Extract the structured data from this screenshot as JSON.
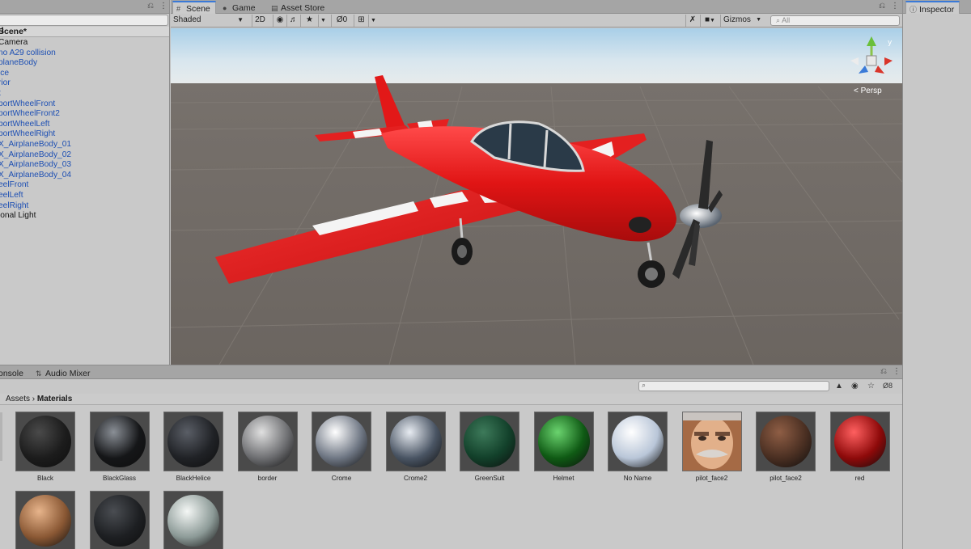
{
  "hierarchy": {
    "scene_name": "Scene*",
    "items": [
      {
        "label": "Camera",
        "color": "black"
      },
      {
        "label": "no A29 collision",
        "color": "blue"
      },
      {
        "label": "planeBody",
        "color": "blue"
      },
      {
        "label": "ice",
        "color": "blue"
      },
      {
        "label": "rior",
        "color": "blue"
      },
      {
        "label": "t",
        "color": "blue"
      },
      {
        "label": "portWheelFront",
        "color": "blue"
      },
      {
        "label": "portWheelFront2",
        "color": "blue"
      },
      {
        "label": "portWheelLeft",
        "color": "blue"
      },
      {
        "label": "portWheelRight",
        "color": "blue"
      },
      {
        "label": "X_AirplaneBody_01",
        "color": "blue"
      },
      {
        "label": "X_AirplaneBody_02",
        "color": "blue"
      },
      {
        "label": "X_AirplaneBody_03",
        "color": "blue"
      },
      {
        "label": "X_AirplaneBody_04",
        "color": "blue"
      },
      {
        "label": "eelFront",
        "color": "blue"
      },
      {
        "label": "eelLeft",
        "color": "blue"
      },
      {
        "label": "eelRight",
        "color": "blue"
      },
      {
        "label": "ional Light",
        "color": "black"
      }
    ]
  },
  "scene_tabs": [
    {
      "label": "Scene",
      "icon": "grid-icon"
    },
    {
      "label": "Game",
      "icon": "gamepad-icon"
    },
    {
      "label": "Asset Store",
      "icon": "store-icon"
    }
  ],
  "scene_toolbar": {
    "shading_mode": "Shaded",
    "mode_2d": "2D",
    "hidden_count": "0",
    "gizmos": "Gizmos",
    "search_placeholder": "All"
  },
  "viewport": {
    "projection_label": "< Persp"
  },
  "inspector": {
    "tab_label": "Inspector"
  },
  "project": {
    "tabs": [
      {
        "label": "onsole"
      },
      {
        "label": "Audio Mixer"
      }
    ],
    "layer_count": "8",
    "breadcrumb": {
      "root": "Assets",
      "current": "Materials"
    },
    "materials": [
      {
        "name": "Black",
        "type": "sphere",
        "base": "#1c1c1c",
        "hi": "#4a4a4a"
      },
      {
        "name": "BlackGlass",
        "type": "sphere",
        "base": "#151618",
        "hi": "#8a8f96"
      },
      {
        "name": "BlackHelice",
        "type": "sphere",
        "base": "#202226",
        "hi": "#5a5e66"
      },
      {
        "name": "border",
        "type": "sphere",
        "base": "#6e6f72",
        "hi": "#e0e0e0"
      },
      {
        "name": "Crome",
        "type": "sphere",
        "base": "#6f7784",
        "hi": "#ffffff"
      },
      {
        "name": "Crome2",
        "type": "sphere",
        "base": "#4a5564",
        "hi": "#e8ecf2"
      },
      {
        "name": "GreenSuit",
        "type": "sphere",
        "base": "#12402a",
        "hi": "#3d7a5a"
      },
      {
        "name": "Helmet",
        "type": "sphere",
        "base": "#0f5a14",
        "hi": "#6bd46f"
      },
      {
        "name": "No Name",
        "type": "sphere",
        "base": "#b9c6d8",
        "hi": "#ffffff"
      },
      {
        "name": "pilot_face2",
        "type": "face",
        "base": "#a56a45",
        "hi": "#e2b08a"
      },
      {
        "name": "pilot_face2",
        "type": "sphere",
        "base": "#4a2f22",
        "hi": "#8f5e45"
      },
      {
        "name": "red",
        "type": "sphere",
        "base": "#8e0a0a",
        "hi": "#ff6060"
      },
      {
        "name": "",
        "type": "sphere",
        "base": "#8a5834",
        "hi": "#e7b48b"
      },
      {
        "name": "",
        "type": "sphere",
        "base": "#1d1f22",
        "hi": "#4a4d52"
      },
      {
        "name": "",
        "type": "sphere",
        "base": "#8c9a97",
        "hi": "#f4f7f5"
      }
    ]
  },
  "colors": {
    "accent": "#3a79d7",
    "plane_red": "#e41e1e",
    "ground": "#6e6963",
    "sky": "#cfe2f0"
  }
}
